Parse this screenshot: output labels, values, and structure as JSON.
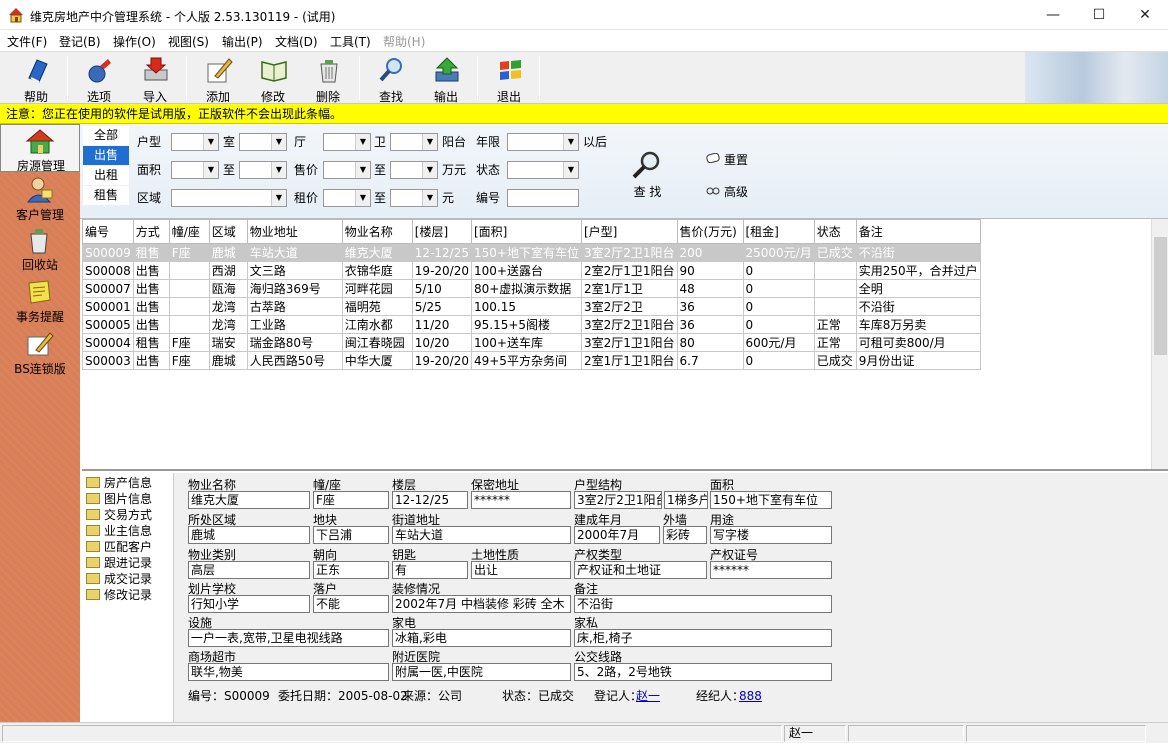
{
  "window": {
    "title": "维克房地产中介管理系统 - 个人版 2.53.130119 - (试用)",
    "minimize": "—",
    "maximize": "☐",
    "close": "✕"
  },
  "menu": [
    "文件(F)",
    "登记(B)",
    "操作(O)",
    "视图(S)",
    "输出(P)",
    "文档(D)",
    "工具(T)",
    "帮助(H)"
  ],
  "toolbar": {
    "help": "帮助",
    "options": "选项",
    "import": "导入",
    "add": "添加",
    "edit": "修改",
    "delete": "删除",
    "search": "查找",
    "export": "输出",
    "exit": "退出"
  },
  "notice": "注意：您正在使用的软件是试用版，正版软件不会出现此条幅。",
  "sidebar": {
    "property": "房源管理",
    "customer": "客户管理",
    "recycle": "回收站",
    "reminder": "事务提醒",
    "bs": "BS连锁版"
  },
  "filter": {
    "tabs": [
      "全部",
      "出售",
      "出租",
      "租售"
    ],
    "labels": {
      "layout": "户型",
      "room": "室",
      "hall": "厅",
      "bath": "卫",
      "balcony": "阳台",
      "age": "年限",
      "after": "以后",
      "area": "面积",
      "to": "至",
      "to2": "至",
      "to3": "至",
      "to4": "至",
      "price": "售价",
      "wan": "万元",
      "status": "状态",
      "region": "区域",
      "rent": "租价",
      "yuan": "元",
      "code": "编号"
    },
    "search": "查 找",
    "reset": "重置",
    "advanced": "高级"
  },
  "grid": {
    "columns": [
      "编号",
      "方式",
      "幢/座",
      "区域",
      "物业地址",
      "物业名称",
      "[楼层]",
      "[面积]",
      "[户型]",
      "售价(万元)",
      "[租金]",
      "状态",
      "备注"
    ],
    "rows": [
      [
        "S00009",
        "租售",
        "F座",
        "鹿城",
        "车站大道",
        "维克大厦",
        "12-12/25",
        "150+地下室有车位",
        "3室2厅2卫1阳台",
        "200",
        "25000元/月",
        "已成交",
        "不沿街"
      ],
      [
        "S00008",
        "出售",
        "",
        "西湖",
        "文三路",
        "衣锦华庭",
        "19-20/20",
        "100+送露台",
        "2室2厅1卫1阳台",
        "90",
        "0",
        "",
        "实用250平，合并过户"
      ],
      [
        "S00007",
        "出售",
        "",
        "瓯海",
        "海归路369号",
        "河畔花园",
        "5/10",
        "80+虚拟演示数据",
        "2室1厅1卫",
        "48",
        "0",
        "",
        "全明"
      ],
      [
        "S00001",
        "出售",
        "",
        "龙湾",
        "古萃路",
        "福明苑",
        "5/25",
        "100.15",
        "3室2厅2卫",
        "36",
        "0",
        "",
        "不沿街"
      ],
      [
        "S00005",
        "出售",
        "",
        "龙湾",
        "工业路",
        "江南水都",
        "11/20",
        "95.15+5阁楼",
        "3室2厅2卫1阳台",
        "36",
        "0",
        "正常",
        "车库8万另卖"
      ],
      [
        "S00004",
        "租售",
        "F座",
        "瑞安",
        "瑞金路80号",
        "闽江春晓园",
        "10/20",
        "100+送车库",
        "3室2厅1卫1阳台",
        "80",
        "600元/月",
        "正常",
        "可租可卖800/月"
      ],
      [
        "S00003",
        "出售",
        "F座",
        "鹿城",
        "人民西路50号",
        "中华大厦",
        "19-20/20",
        "49+5平方杂务间",
        "2室1厅1卫1阳台",
        "6.7",
        "0",
        "已成交",
        "9月份出证"
      ]
    ]
  },
  "tree": [
    "房产信息",
    "图片信息",
    "交易方式",
    "业主信息",
    "匹配客户",
    "跟进记录",
    "成交记录",
    "修改记录"
  ],
  "detail": {
    "l_name": "物业名称",
    "v_name": "维克大厦",
    "l_block": "幢/座",
    "v_block": "F座",
    "l_floor": "楼层",
    "v_floor": "12-12/25",
    "l_secret": "保密地址",
    "v_secret": "******",
    "l_struct": "户型结构",
    "v_struct": "3室2厅2卫1阳台",
    "v_struct2": "1梯多户",
    "l_area": "面积",
    "v_area": "150+地下室有车位",
    "l_region": "所处区域",
    "v_region": "鹿城",
    "l_plot": "地块",
    "v_plot": "下吕浦",
    "l_street": "街道地址",
    "v_street": "车站大道",
    "l_built": "建成年月",
    "v_built": "2000年7月",
    "l_wall": "外墙",
    "v_wall": "彩砖",
    "l_use": "用途",
    "v_use": "写字楼",
    "l_type": "物业类别",
    "v_type": "高层",
    "l_orient": "朝向",
    "v_orient": "正东",
    "l_key": "钥匙",
    "v_key": "有",
    "l_land": "土地性质",
    "v_land": "出让",
    "l_proptype": "产权类型",
    "v_proptype": "产权证和土地证",
    "l_certno": "产权证号",
    "v_certno": "******",
    "l_school": "划片学校",
    "v_school": "行知小学",
    "l_hukou": "落户",
    "v_hukou": "不能",
    "l_decor": "装修情况",
    "v_decor": "2002年7月 中档装修 彩砖 全木",
    "l_remark": "备注",
    "v_remark": "不沿街",
    "l_facility": "设施",
    "v_facility": "一户一表,宽带,卫星电视线路",
    "l_appliance": "家电",
    "v_appliance": "冰箱,彩电",
    "l_furniture": "家私",
    "v_furniture": "床,柜,椅子",
    "l_market": "商场超市",
    "v_market": "联华,物美",
    "l_hospital": "附近医院",
    "v_hospital": "附属一医,中医院",
    "l_bus": "公交线路",
    "v_bus": "5、2路，2号地铁",
    "f_code": "编号：S00009",
    "f_date": "委托日期：2005-08-02",
    "f_source": "来源：公司",
    "f_status": "状态：已成交",
    "f_reg_label": "登记人：",
    "f_reg": "赵一",
    "f_agent_label": "经纪人：",
    "f_agent": "888"
  },
  "statusbar": {
    "user": "赵一"
  }
}
